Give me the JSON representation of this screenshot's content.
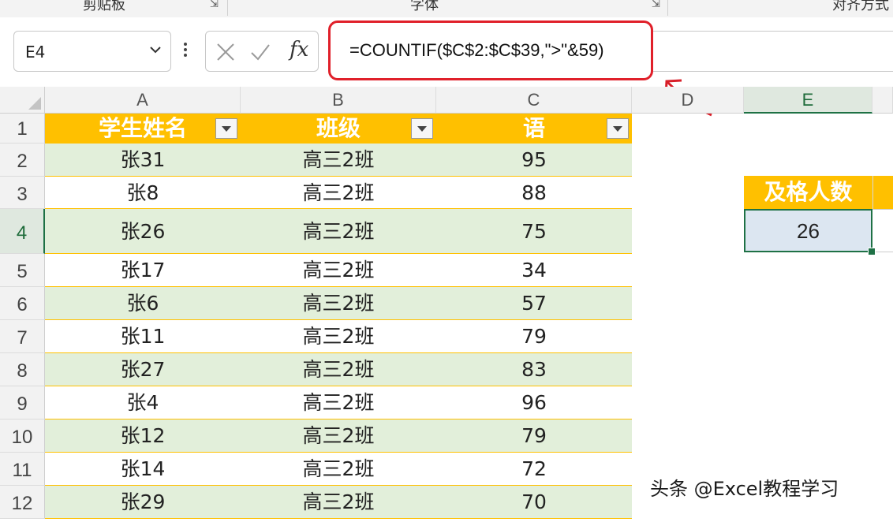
{
  "ribbon": {
    "groups": [
      "剪贴板",
      "字体",
      "对齐方式"
    ]
  },
  "formula_bar": {
    "name_box": "E4",
    "cancel_icon": "x-icon",
    "enter_icon": "check-icon",
    "fx_label": "fx",
    "formula": "=COUNTIF($C$2:$C$39,\">\"&59)"
  },
  "columns": [
    "A",
    "B",
    "C",
    "D",
    "E"
  ],
  "header_row": {
    "row": "1",
    "a": "学生姓名",
    "b": "班级",
    "c": "语"
  },
  "rows": [
    {
      "row": "2",
      "name": "张31",
      "class": "高三2班",
      "score": "95"
    },
    {
      "row": "3",
      "name": "张8",
      "class": "高三2班",
      "score": "88"
    },
    {
      "row": "4",
      "name": "张26",
      "class": "高三2班",
      "score": "75"
    },
    {
      "row": "5",
      "name": "张17",
      "class": "高三2班",
      "score": "34"
    },
    {
      "row": "6",
      "name": "张6",
      "class": "高三2班",
      "score": "57"
    },
    {
      "row": "7",
      "name": "张11",
      "class": "高三2班",
      "score": "79"
    },
    {
      "row": "8",
      "name": "张27",
      "class": "高三2班",
      "score": "83"
    },
    {
      "row": "9",
      "name": "张4",
      "class": "高三2班",
      "score": "96"
    },
    {
      "row": "10",
      "name": "张12",
      "class": "高三2班",
      "score": "79"
    },
    {
      "row": "11",
      "name": "张14",
      "class": "高三2班",
      "score": "72"
    },
    {
      "row": "12",
      "name": "张29",
      "class": "高三2班",
      "score": "70"
    }
  ],
  "summary": {
    "label": "及格人数",
    "value": "26"
  },
  "watermark": "头条 @Excel教程学习",
  "colors": {
    "header_fill": "#ffc000",
    "band_fill": "#e2efda",
    "selection": "#1e7145",
    "highlight_box": "#e0202a"
  }
}
